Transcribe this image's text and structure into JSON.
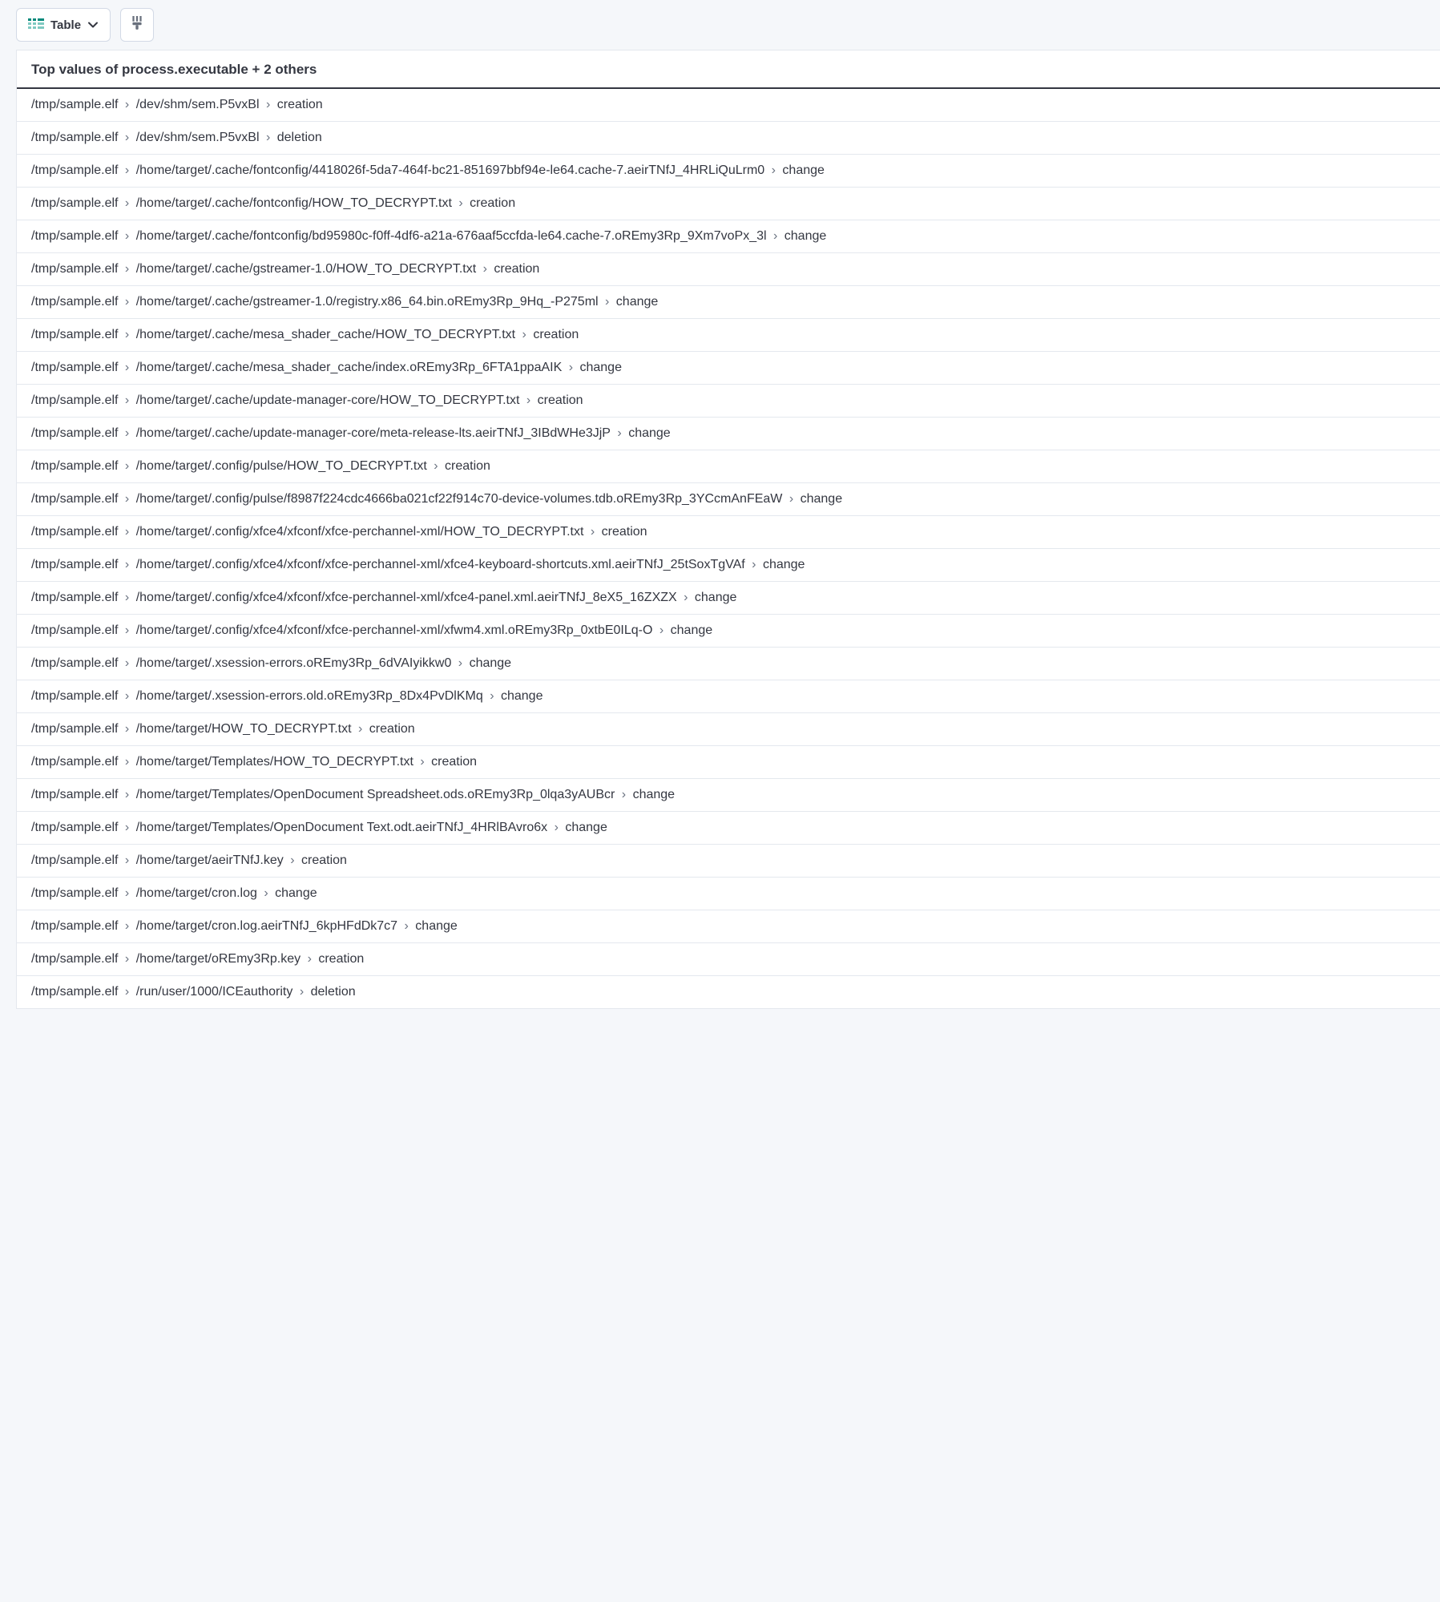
{
  "toolbar": {
    "table_label": "Table"
  },
  "panel": {
    "header": "Top values of process.executable + 2 others",
    "separator": "›",
    "rows": [
      {
        "parts": [
          "/tmp/sample.elf",
          "/dev/shm/sem.P5vxBl",
          "creation"
        ]
      },
      {
        "parts": [
          "/tmp/sample.elf",
          "/dev/shm/sem.P5vxBl",
          "deletion"
        ]
      },
      {
        "parts": [
          "/tmp/sample.elf",
          "/home/target/.cache/fontconfig/4418026f-5da7-464f-bc21-851697bbf94e-le64.cache-7.aeirTNfJ_4HRLiQuLrm0",
          "change"
        ]
      },
      {
        "parts": [
          "/tmp/sample.elf",
          "/home/target/.cache/fontconfig/HOW_TO_DECRYPT.txt",
          "creation"
        ]
      },
      {
        "parts": [
          "/tmp/sample.elf",
          "/home/target/.cache/fontconfig/bd95980c-f0ff-4df6-a21a-676aaf5ccfda-le64.cache-7.oREmy3Rp_9Xm7voPx_3l",
          "change"
        ]
      },
      {
        "parts": [
          "/tmp/sample.elf",
          "/home/target/.cache/gstreamer-1.0/HOW_TO_DECRYPT.txt",
          "creation"
        ]
      },
      {
        "parts": [
          "/tmp/sample.elf",
          "/home/target/.cache/gstreamer-1.0/registry.x86_64.bin.oREmy3Rp_9Hq_-P275ml",
          "change"
        ]
      },
      {
        "parts": [
          "/tmp/sample.elf",
          "/home/target/.cache/mesa_shader_cache/HOW_TO_DECRYPT.txt",
          "creation"
        ]
      },
      {
        "parts": [
          "/tmp/sample.elf",
          "/home/target/.cache/mesa_shader_cache/index.oREmy3Rp_6FTA1ppaAIK",
          "change"
        ]
      },
      {
        "parts": [
          "/tmp/sample.elf",
          "/home/target/.cache/update-manager-core/HOW_TO_DECRYPT.txt",
          "creation"
        ]
      },
      {
        "parts": [
          "/tmp/sample.elf",
          "/home/target/.cache/update-manager-core/meta-release-lts.aeirTNfJ_3IBdWHe3JjP",
          "change"
        ]
      },
      {
        "parts": [
          "/tmp/sample.elf",
          "/home/target/.config/pulse/HOW_TO_DECRYPT.txt",
          "creation"
        ]
      },
      {
        "parts": [
          "/tmp/sample.elf",
          "/home/target/.config/pulse/f8987f224cdc4666ba021cf22f914c70-device-volumes.tdb.oREmy3Rp_3YCcmAnFEaW",
          "change"
        ]
      },
      {
        "parts": [
          "/tmp/sample.elf",
          "/home/target/.config/xfce4/xfconf/xfce-perchannel-xml/HOW_TO_DECRYPT.txt",
          "creation"
        ]
      },
      {
        "parts": [
          "/tmp/sample.elf",
          "/home/target/.config/xfce4/xfconf/xfce-perchannel-xml/xfce4-keyboard-shortcuts.xml.aeirTNfJ_25tSoxTgVAf",
          "change"
        ]
      },
      {
        "parts": [
          "/tmp/sample.elf",
          "/home/target/.config/xfce4/xfconf/xfce-perchannel-xml/xfce4-panel.xml.aeirTNfJ_8eX5_16ZXZX",
          "change"
        ]
      },
      {
        "parts": [
          "/tmp/sample.elf",
          "/home/target/.config/xfce4/xfconf/xfce-perchannel-xml/xfwm4.xml.oREmy3Rp_0xtbE0ILq-O",
          "change"
        ]
      },
      {
        "parts": [
          "/tmp/sample.elf",
          "/home/target/.xsession-errors.oREmy3Rp_6dVAIyikkw0",
          "change"
        ]
      },
      {
        "parts": [
          "/tmp/sample.elf",
          "/home/target/.xsession-errors.old.oREmy3Rp_8Dx4PvDlKMq",
          "change"
        ]
      },
      {
        "parts": [
          "/tmp/sample.elf",
          "/home/target/HOW_TO_DECRYPT.txt",
          "creation"
        ]
      },
      {
        "parts": [
          "/tmp/sample.elf",
          "/home/target/Templates/HOW_TO_DECRYPT.txt",
          "creation"
        ]
      },
      {
        "parts": [
          "/tmp/sample.elf",
          "/home/target/Templates/OpenDocument Spreadsheet.ods.oREmy3Rp_0lqa3yAUBcr",
          "change"
        ]
      },
      {
        "parts": [
          "/tmp/sample.elf",
          "/home/target/Templates/OpenDocument Text.odt.aeirTNfJ_4HRlBAvro6x",
          "change"
        ]
      },
      {
        "parts": [
          "/tmp/sample.elf",
          "/home/target/aeirTNfJ.key",
          "creation"
        ]
      },
      {
        "parts": [
          "/tmp/sample.elf",
          "/home/target/cron.log",
          "change"
        ]
      },
      {
        "parts": [
          "/tmp/sample.elf",
          "/home/target/cron.log.aeirTNfJ_6kpHFdDk7c7",
          "change"
        ]
      },
      {
        "parts": [
          "/tmp/sample.elf",
          "/home/target/oREmy3Rp.key",
          "creation"
        ]
      },
      {
        "parts": [
          "/tmp/sample.elf",
          "/run/user/1000/ICEauthority",
          "deletion"
        ]
      }
    ]
  }
}
